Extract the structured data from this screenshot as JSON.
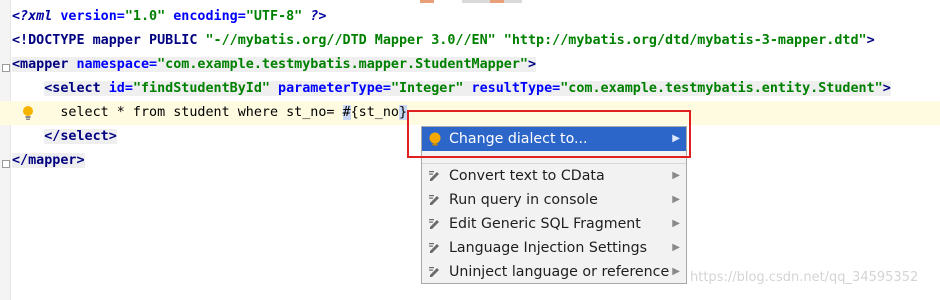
{
  "editor": {
    "line1": {
      "pi_open": "<?",
      "xml": "xml",
      "version_attr": " version=",
      "version_val": "\"1.0\"",
      "encoding_attr": " encoding=",
      "encoding_val": "\"UTF-8\"",
      "pi_close": " ?>"
    },
    "line2": {
      "doctype": "<!DOCTYPE mapper PUBLIC ",
      "public_id": "\"-//mybatis.org//DTD Mapper 3.0//EN\"",
      "space": " ",
      "system_id": "\"http://mybatis.org/dtd/mybatis-3-mapper.dtd\"",
      "close": ">"
    },
    "line3": {
      "open": "<mapper",
      "ns_attr": " namespace=",
      "ns_val": "\"com.example.testmybatis.mapper.StudentMapper\"",
      "close": ">"
    },
    "line4": {
      "indent": "    ",
      "open": "<select",
      "id_attr": " id=",
      "id_val": "\"findStudentById\"",
      "pt_attr": " parameterType=",
      "pt_val": "\"Integer\"",
      "rt_attr": " resultType=",
      "rt_val": "\"com.example.testmybatis.entity.Student\"",
      "close": ">"
    },
    "line5": {
      "indent": "      ",
      "sql_before": "select * from student where st_no= ",
      "sql_hash": "#",
      "sql_param": "{st_no",
      "sql_end": "}"
    },
    "line6": {
      "indent": "    ",
      "close_select": "</select>"
    },
    "line7": {
      "close_mapper": "</mapper>"
    }
  },
  "context_menu": {
    "items": [
      {
        "label": "Change dialect to...",
        "icon": "bulb-icon",
        "highlighted": true
      },
      {
        "label": "Convert text to CData",
        "icon": "intention-icon"
      },
      {
        "label": "Run query in console",
        "icon": "intention-icon"
      },
      {
        "label": "Edit Generic SQL Fragment",
        "icon": "intention-icon"
      },
      {
        "label": "Language Injection Settings",
        "icon": "intention-icon"
      },
      {
        "label": "Uninject language or reference",
        "icon": "intention-icon"
      }
    ],
    "submenu_glyph": "▶"
  },
  "colors": {
    "highlight": "#2c66c9",
    "annotation_box": "#e02020"
  },
  "watermark": "https://blog.csdn.net/qq_34595352"
}
